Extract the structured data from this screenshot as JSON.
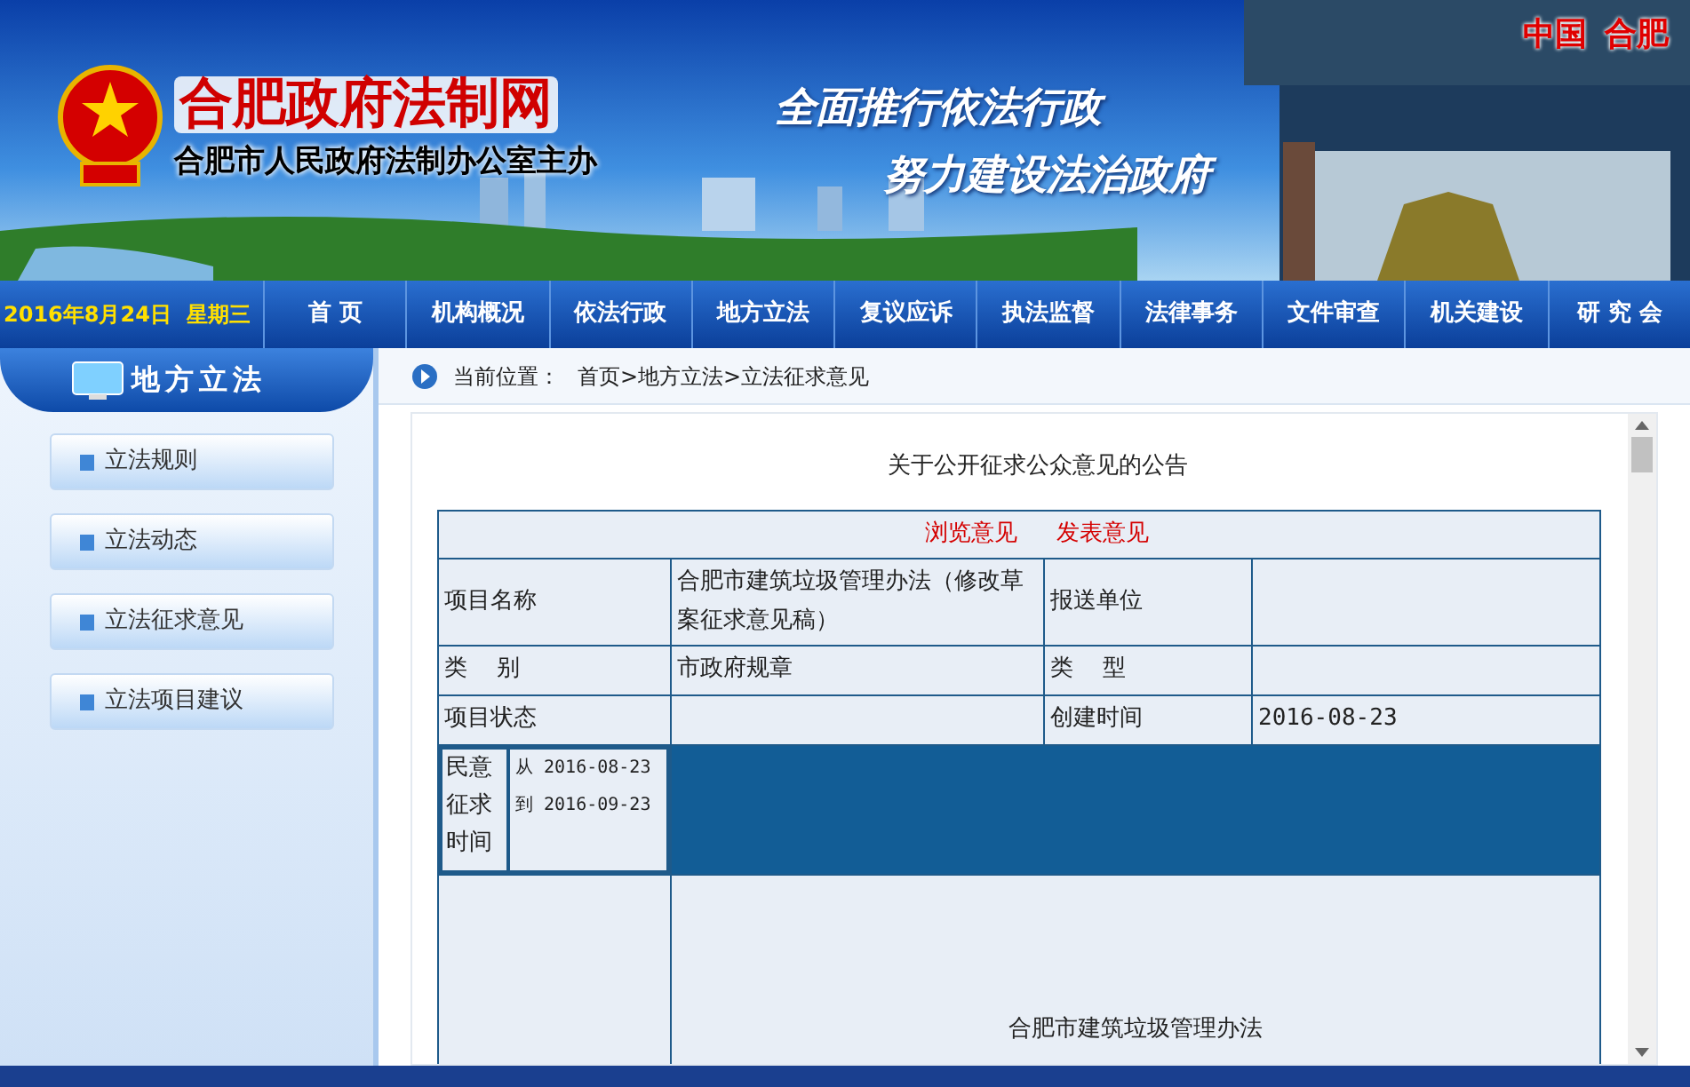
{
  "header": {
    "site_title": "合肥政府法制网",
    "subtitle": "合肥市人民政府法制办公室主办",
    "slogan_1": "全面推行依法行政",
    "slogan_2": "努力建设法治政府",
    "region_1": "中国",
    "region_2": "合肥"
  },
  "nav": {
    "date": "2016年8月24日  星期三",
    "items": [
      "首 页",
      "机构概况",
      "依法行政",
      "地方立法",
      "复议应诉",
      "执法监督",
      "法律事务",
      "文件审查",
      "机关建设",
      "研 究 会"
    ]
  },
  "sidebar": {
    "title": "地方立法",
    "items": [
      "立法规则",
      "立法动态",
      "立法征求意见",
      "立法项目建议"
    ]
  },
  "breadcrumb": {
    "label": "当前位置：",
    "path": "首页>地方立法>立法征求意见"
  },
  "article": {
    "title": "关于公开征求公众意见的公告",
    "links": [
      "浏览意见",
      "发表意见"
    ],
    "rows": [
      {
        "label_1": "项目名称",
        "value_1": "合肥市建筑垃圾管理办法（修改草案征求意见稿）",
        "label_2": "报送单位",
        "value_2": ""
      },
      {
        "label_1": "类    别",
        "value_1": "市政府规章",
        "label_2": "类    型",
        "value_2": ""
      },
      {
        "label_1": "项目状态",
        "value_1": "",
        "label_2": "创建时间",
        "value_2": "2016-08-23"
      }
    ],
    "period_label": "民意征求时间",
    "period_value": "从 2016-08-23 到 2016-09-23",
    "body_title": "合肥市建筑垃圾管理办法"
  }
}
